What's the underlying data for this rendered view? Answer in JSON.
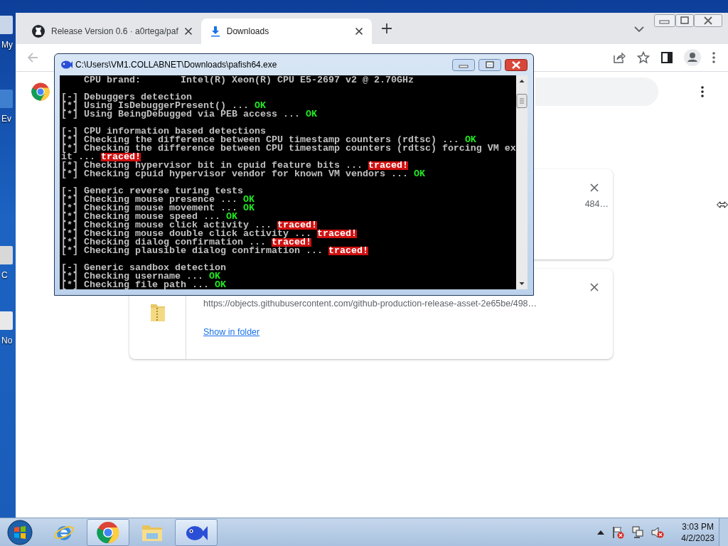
{
  "desktop": {
    "icons": [
      {
        "label": "My"
      },
      {
        "label": "Ev"
      },
      {
        "label": "C"
      },
      {
        "label": "No"
      }
    ]
  },
  "browser": {
    "tabs": [
      {
        "title": "Release Version 0.6 · a0rtega/paf",
        "kind": "github",
        "selected": false
      },
      {
        "title": "Downloads",
        "kind": "download",
        "selected": true
      }
    ],
    "downloads": [
      {
        "url": "484…"
      },
      {
        "url": "https://objects.githubusercontent.com/github-production-release-asset-2e65be/498…",
        "link": "Show in folder"
      }
    ]
  },
  "console": {
    "title": "C:\\Users\\VM1.COLLABNET\\Downloads\\pafish64.exe",
    "lines": [
      {
        "kind": "text",
        "text": "    CPU brand:       Intel(R) Xeon(R) CPU E5-2697 v2 @ 2.70GHz"
      },
      {
        "kind": "blank"
      },
      {
        "kind": "text",
        "text": "[-] Debuggers detection"
      },
      {
        "kind": "text",
        "text": "[*] Using IsDebuggerPresent() ... ",
        "result": {
          "kind": "ok",
          "label": "OK"
        }
      },
      {
        "kind": "text",
        "text": "[*] Using BeingDebugged via PEB access ... ",
        "result": {
          "kind": "ok",
          "label": "OK"
        }
      },
      {
        "kind": "blank"
      },
      {
        "kind": "text",
        "text": "[-] CPU information based detections"
      },
      {
        "kind": "text",
        "text": "[*] Checking the difference between CPU timestamp counters (rdtsc) ... ",
        "result": {
          "kind": "ok",
          "label": "OK"
        }
      },
      {
        "kind": "text",
        "text": "[*] Checking the difference between CPU timestamp counters (rdtsc) forcing VM ex"
      },
      {
        "kind": "text",
        "text": "it ... ",
        "result": {
          "kind": "traced",
          "label": "traced!"
        }
      },
      {
        "kind": "text",
        "text": "[*] Checking hypervisor bit in cpuid feature bits ... ",
        "result": {
          "kind": "traced",
          "label": "traced!"
        }
      },
      {
        "kind": "text",
        "text": "[*] Checking cpuid hypervisor vendor for known VM vendors ... ",
        "result": {
          "kind": "ok",
          "label": "OK"
        }
      },
      {
        "kind": "blank"
      },
      {
        "kind": "text",
        "text": "[-] Generic reverse turing tests"
      },
      {
        "kind": "text",
        "text": "[*] Checking mouse presence ... ",
        "result": {
          "kind": "ok",
          "label": "OK"
        }
      },
      {
        "kind": "text",
        "text": "[*] Checking mouse movement ... ",
        "result": {
          "kind": "ok",
          "label": "OK"
        }
      },
      {
        "kind": "text",
        "text": "[*] Checking mouse speed ... ",
        "result": {
          "kind": "ok",
          "label": "OK"
        }
      },
      {
        "kind": "text",
        "text": "[*] Checking mouse click activity ... ",
        "result": {
          "kind": "traced",
          "label": "traced!"
        }
      },
      {
        "kind": "text",
        "text": "[*] Checking mouse double click activity ... ",
        "result": {
          "kind": "traced",
          "label": "traced!"
        }
      },
      {
        "kind": "text",
        "text": "[*] Checking dialog confirmation ... ",
        "result": {
          "kind": "traced",
          "label": "traced!"
        }
      },
      {
        "kind": "text",
        "text": "[*] Checking plausible dialog confirmation ... ",
        "result": {
          "kind": "traced",
          "label": "traced!"
        }
      },
      {
        "kind": "blank"
      },
      {
        "kind": "text",
        "text": "[-] Generic sandbox detection"
      },
      {
        "kind": "text",
        "text": "[*] Checking username ... ",
        "result": {
          "kind": "ok",
          "label": "OK"
        }
      },
      {
        "kind": "text",
        "text": "[*] Checking file path ... ",
        "result": {
          "kind": "ok",
          "label": "OK"
        }
      }
    ]
  },
  "taskbar": {
    "apps": [
      {
        "kind": "ie",
        "active": false
      },
      {
        "kind": "chrome",
        "active": true
      },
      {
        "kind": "explorer",
        "active": false
      },
      {
        "kind": "fish",
        "active": true
      }
    ],
    "time": "3:03 PM",
    "date": "4/2/2023"
  }
}
